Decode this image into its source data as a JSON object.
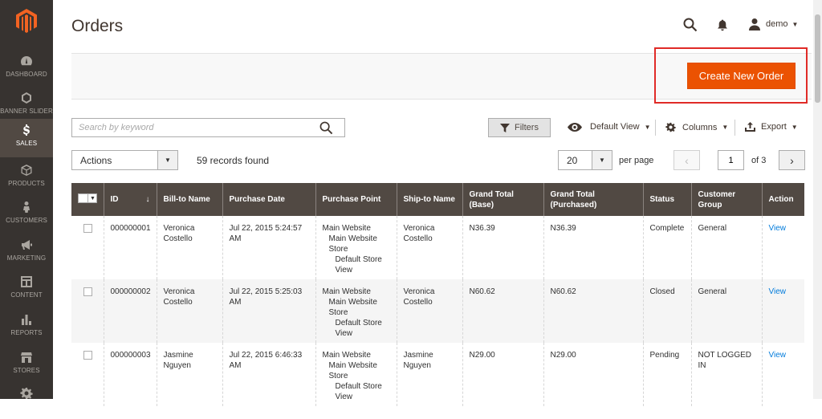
{
  "sidebar": {
    "items": [
      {
        "label": "DASHBOARD",
        "icon": "dashboard-icon"
      },
      {
        "label": "BANNER SLIDER",
        "icon": "hexagon-icon"
      },
      {
        "label": "SALES",
        "icon": "dollar-icon",
        "active": true
      },
      {
        "label": "PRODUCTS",
        "icon": "cube-icon"
      },
      {
        "label": "CUSTOMERS",
        "icon": "person-icon"
      },
      {
        "label": "MARKETING",
        "icon": "megaphone-icon"
      },
      {
        "label": "CONTENT",
        "icon": "layout-icon"
      },
      {
        "label": "REPORTS",
        "icon": "bar-chart-icon"
      },
      {
        "label": "STORES",
        "icon": "store-icon"
      }
    ]
  },
  "header": {
    "title": "Orders",
    "user": "demo"
  },
  "action_bar": {
    "create_label": "Create New Order",
    "accent": "#eb5202",
    "highlight_color": "#e02b27"
  },
  "toolbar": {
    "search_placeholder": "Search by keyword",
    "filters_label": "Filters",
    "view_label": "Default View",
    "columns_label": "Columns",
    "export_label": "Export"
  },
  "grid_controls": {
    "actions_label": "Actions",
    "records_found": "59 records found",
    "per_page_value": "20",
    "per_page_label": "per page",
    "current_page": "1",
    "of_pages": "of 3"
  },
  "table": {
    "headers": {
      "id": "ID",
      "bill_to": "Bill-to Name",
      "purchase_date": "Purchase Date",
      "purchase_point": "Purchase Point",
      "ship_to": "Ship-to Name",
      "grand_base": "Grand Total (Base)",
      "grand_purchased": "Grand Total (Purchased)",
      "status": "Status",
      "customer_group": "Customer Group",
      "action": "Action"
    },
    "rows": [
      {
        "id": "000000001",
        "bill_to": "Veronica Costello",
        "purchase_date": "Jul 22, 2015 5:24:57 AM",
        "pp1": "Main Website",
        "pp2": "Main Website Store",
        "pp3": "Default Store View",
        "ship_to": "Veronica Costello",
        "grand_base": "N36.39",
        "grand_purchased": "N36.39",
        "status": "Complete",
        "customer_group": "General",
        "action": "View"
      },
      {
        "id": "000000002",
        "bill_to": "Veronica Costello",
        "purchase_date": "Jul 22, 2015 5:25:03 AM",
        "pp1": "Main Website",
        "pp2": "Main Website Store",
        "pp3": "Default Store View",
        "ship_to": "Veronica Costello",
        "grand_base": "N60.62",
        "grand_purchased": "N60.62",
        "status": "Closed",
        "customer_group": "General",
        "action": "View"
      },
      {
        "id": "000000003",
        "bill_to": "Jasmine Nguyen",
        "purchase_date": "Jul 22, 2015 6:46:33 AM",
        "pp1": "Main Website",
        "pp2": "Main Website Store",
        "pp3": "Default Store View",
        "ship_to": "Jasmine Nguyen",
        "grand_base": "N29.00",
        "grand_purchased": "N29.00",
        "status": "Pending",
        "customer_group": "NOT LOGGED IN",
        "action": "View"
      }
    ]
  }
}
